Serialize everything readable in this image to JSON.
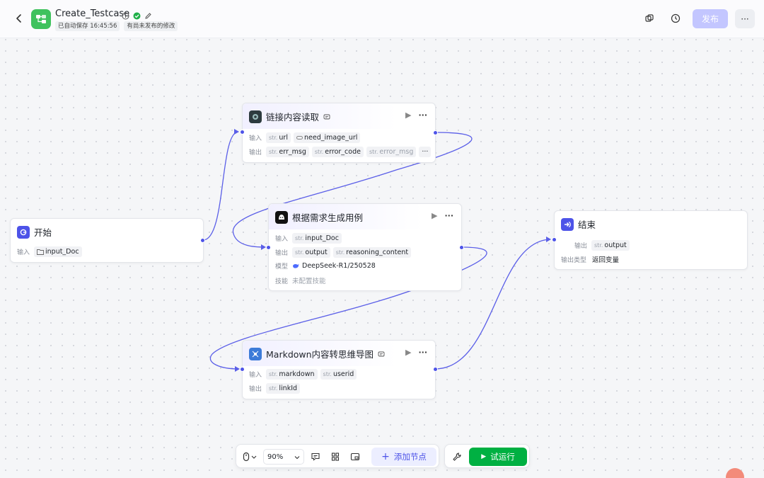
{
  "header": {
    "title": "Create_Testcase",
    "autosave": "已自动保存 16:45:56",
    "unpublished": "有尚未发布的修改",
    "publish_label": "发布",
    "more_label": "···"
  },
  "nodes": {
    "start": {
      "title": "开始",
      "input_label": "输入",
      "input_value": "input_Doc"
    },
    "link_reader": {
      "title": "链接内容读取",
      "input_label": "输入",
      "output_label": "输出",
      "inputs": [
        {
          "type": "str.",
          "name": "url"
        },
        {
          "type": "",
          "name": "need_image_url"
        }
      ],
      "outputs": [
        {
          "type": "str.",
          "name": "err_msg"
        },
        {
          "type": "str.",
          "name": "error_code"
        },
        {
          "type": "str.",
          "name": "error_msg"
        }
      ],
      "overflow": "···"
    },
    "generate": {
      "title": "根据需求生成用例",
      "input_label": "输入",
      "output_label": "输出",
      "model_label": "模型",
      "skill_label": "技能",
      "inputs": [
        {
          "type": "str.",
          "name": "input_Doc"
        }
      ],
      "outputs": [
        {
          "type": "str.",
          "name": "output"
        },
        {
          "type": "str.",
          "name": "reasoning_content"
        }
      ],
      "model": "DeepSeek-R1/250528",
      "skill": "未配置技能"
    },
    "mindmap": {
      "title": "Markdown内容转思维导图",
      "input_label": "输入",
      "output_label": "输出",
      "inputs": [
        {
          "type": "str.",
          "name": "markdown"
        },
        {
          "type": "str.",
          "name": "userid"
        }
      ],
      "outputs": [
        {
          "type": "str.",
          "name": "linkId"
        }
      ]
    },
    "end": {
      "title": "结束",
      "output_label": "输出",
      "output_type_label": "输出类型",
      "outputs": [
        {
          "type": "str.",
          "name": "output"
        }
      ],
      "output_type": "返回变量"
    }
  },
  "toolbar": {
    "zoom": "90%",
    "add_node_label": "添加节点",
    "run_label": "试运行"
  },
  "colors": {
    "accent": "#4d53e8",
    "run": "#00b042",
    "publish_disabled": "#c3c6ff"
  }
}
